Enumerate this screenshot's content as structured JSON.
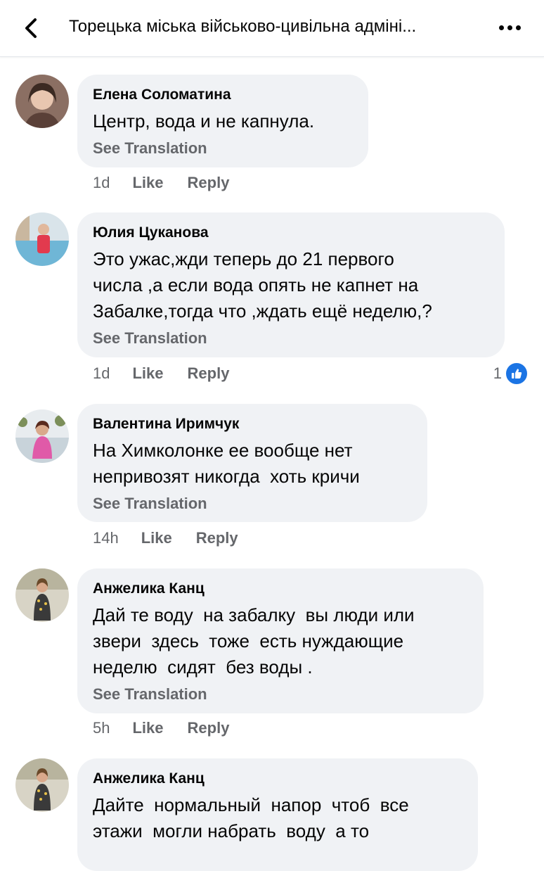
{
  "header": {
    "title": "Торецька міська військово-цивільна адміні..."
  },
  "comments": [
    {
      "author": "Елена Соломатина",
      "text": "Центр, вода и не капнула.",
      "see_translation": "See Translation",
      "time": "1d",
      "like": "Like",
      "reply": "Reply"
    },
    {
      "author": "Юлия Цуканова",
      "text": "Это ужас,жди теперь до 21 первого\nчисла ,а если вода опять не капнет на\nЗабалке,тогда что ,ждать ещё неделю,?",
      "see_translation": "See Translation",
      "time": "1d",
      "like": "Like",
      "reply": "Reply",
      "reaction_count": "1"
    },
    {
      "author": "Валентина Иримчук",
      "text": "На Химколонке ее вообще нет\nнепривозят никогда  хоть кричи",
      "see_translation": "See Translation",
      "time": "14h",
      "like": "Like",
      "reply": "Reply"
    },
    {
      "author": "Анжелика Канц",
      "text": "Дай те воду  на забалку  вы люди или\nзвери  здесь  тоже  есть нуждающие\nнеделю  сидят  без воды .",
      "see_translation": "See Translation",
      "time": "5h",
      "like": "Like",
      "reply": "Reply"
    },
    {
      "author": "Анжелика Канц",
      "text": "Дайте  нормальный  напор  чтоб  все\nэтажи  могли набрать  воду  а то"
    }
  ],
  "colors": {
    "bubble": "#f0f2f5",
    "secondary_text": "#65676b",
    "like_blue": "#1b74e4"
  }
}
